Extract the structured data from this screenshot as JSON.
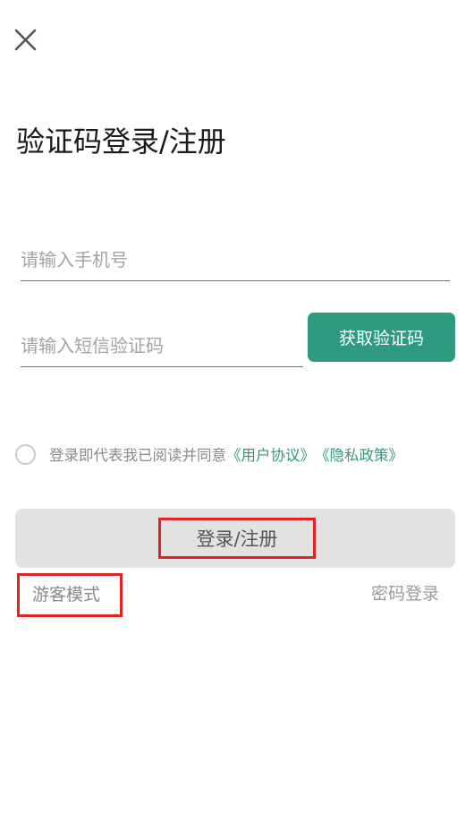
{
  "header": {
    "close_icon": "close-icon",
    "title": "验证码登录/注册"
  },
  "form": {
    "phone_placeholder": "请输入手机号",
    "phone_value": "",
    "code_placeholder": "请输入短信验证码",
    "code_value": "",
    "get_code_label": "获取验证码"
  },
  "agreement": {
    "checked": false,
    "prefix": "登录即代表我已阅读并同意",
    "user_agreement": "《用户协议》",
    "privacy_policy": "《隐私政策》"
  },
  "actions": {
    "login_label": "登录/注册",
    "guest_label": "游客模式",
    "password_login_label": "密码登录"
  },
  "colors": {
    "accent": "#2e9a80",
    "highlight_box": "#e02424",
    "login_button_bg": "#e2e2e2"
  }
}
